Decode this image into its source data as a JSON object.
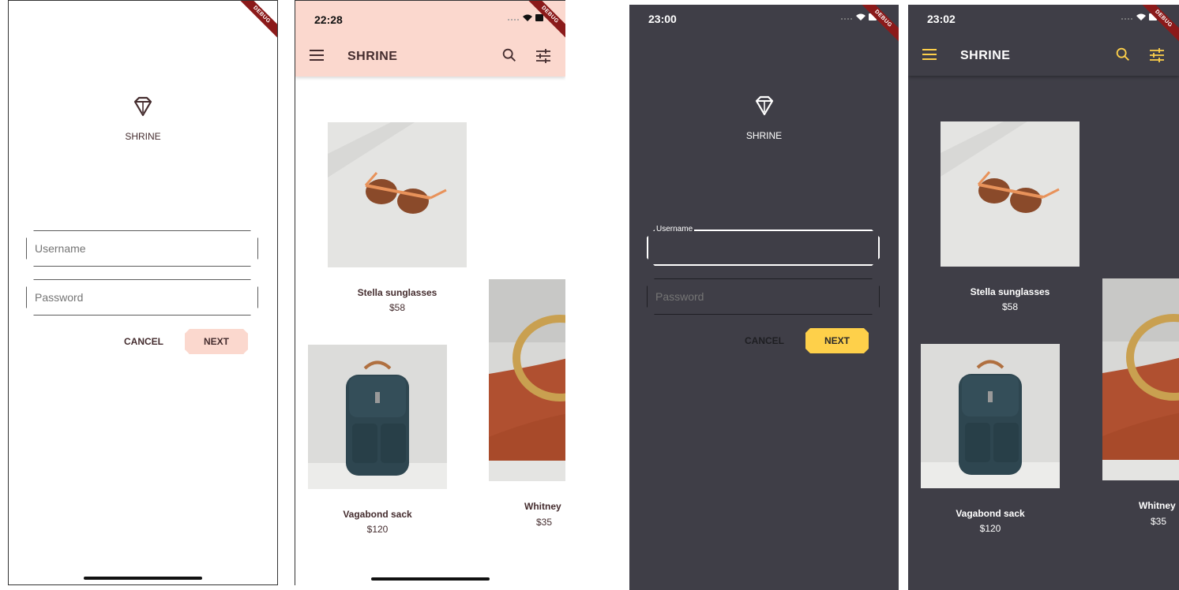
{
  "colors": {
    "light_bg": "#ffffff",
    "light_appbar": "#fbd8ce",
    "light_accent_text": "#442c2e",
    "light_next_button": "#fbd8ce",
    "dark_bg": "#3f3e47",
    "dark_accent": "#fed04a",
    "debug_banner": "#8b1a1a"
  },
  "debug_label": "DEBUG",
  "screens": [
    {
      "id": "login-light",
      "brand": "SHRINE",
      "username_placeholder": "Username",
      "password_placeholder": "Password",
      "cancel_label": "CANCEL",
      "next_label": "NEXT"
    },
    {
      "id": "catalog-light",
      "time": "22:28",
      "title": "SHRINE",
      "products": [
        {
          "name": "Stella sunglasses",
          "price": "$58"
        },
        {
          "name": "Vagabond sack",
          "price": "$120"
        },
        {
          "name": "Whitney",
          "price": "$35"
        }
      ]
    },
    {
      "id": "login-dark",
      "time": "23:00",
      "brand": "SHRINE",
      "username_label": "Username",
      "password_placeholder": "Password",
      "cancel_label": "CANCEL",
      "next_label": "NEXT"
    },
    {
      "id": "catalog-dark",
      "time": "23:02",
      "title": "SHRINE",
      "products": [
        {
          "name": "Stella sunglasses",
          "price": "$58"
        },
        {
          "name": "Vagabond sack",
          "price": "$120"
        },
        {
          "name": "Whitney",
          "price": "$35"
        }
      ]
    }
  ]
}
